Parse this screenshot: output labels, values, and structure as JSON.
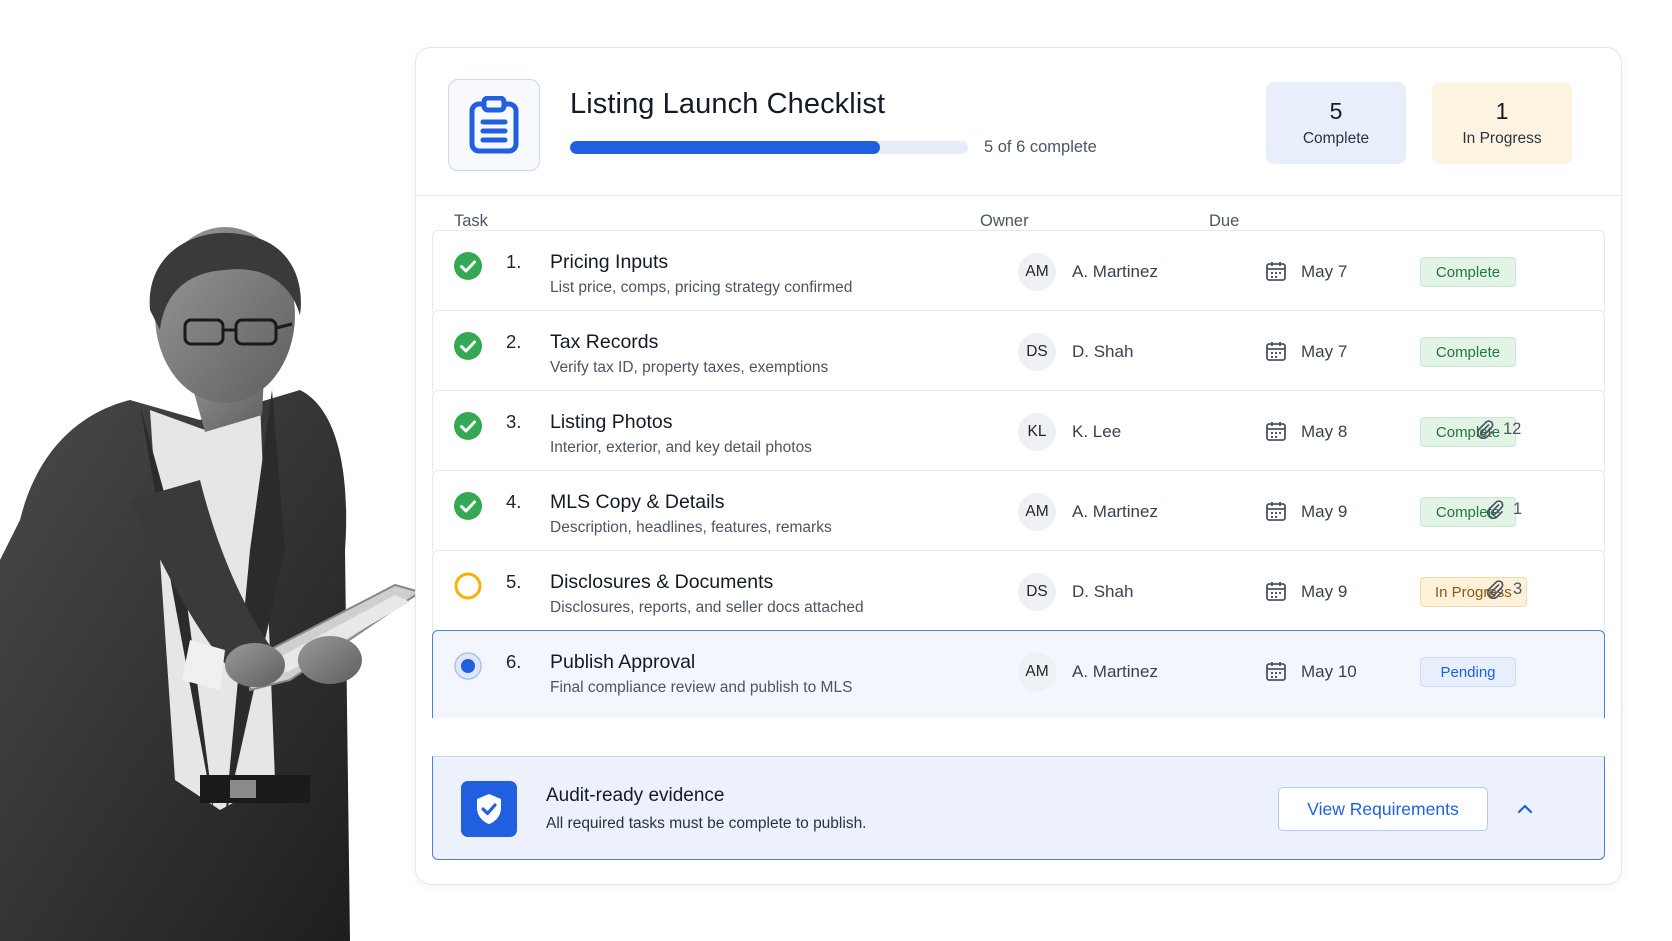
{
  "checklist": {
    "title": "Listing Launch Checklist",
    "progress_text": "5 of 6 complete",
    "progress_fraction": 0.78,
    "icon": "clipboard-icon"
  },
  "stats": [
    {
      "value": "5",
      "label": "Complete"
    },
    {
      "value": "1",
      "label": "In Progress"
    }
  ],
  "columns": {
    "task": "Task",
    "owner": "Owner",
    "due": "Due"
  },
  "tasks": [
    {
      "num": "1.",
      "title": "Pricing Inputs",
      "subtitle": "List price, comps, pricing strategy confirmed",
      "initials": "AM",
      "owner": "A. Martinez",
      "due": "May 7",
      "status": "Complete",
      "attachments": ""
    },
    {
      "num": "2.",
      "title": "Tax Records",
      "subtitle": "Verify tax ID, property taxes, exemptions",
      "initials": "DS",
      "owner": "D. Shah",
      "due": "May 7",
      "status": "Complete",
      "attachments": ""
    },
    {
      "num": "3.",
      "title": "Listing Photos",
      "subtitle": "Interior, exterior, and key detail photos",
      "initials": "KL",
      "owner": "K. Lee",
      "due": "May 8",
      "status": "Complete",
      "attachments": "12"
    },
    {
      "num": "4.",
      "title": "MLS Copy & Details",
      "subtitle": "Description, headlines, features, remarks",
      "initials": "AM",
      "owner": "A. Martinez",
      "due": "May 9",
      "status": "Complete",
      "attachments": "1"
    },
    {
      "num": "5.",
      "title": "Disclosures & Documents",
      "subtitle": "Disclosures, reports, and seller docs attached",
      "initials": "DS",
      "owner": "D. Shah",
      "due": "May 9",
      "status": "In Progress",
      "attachments": "3"
    },
    {
      "num": "6.",
      "title": "Publish Approval",
      "subtitle": "Final compliance review and publish to MLS",
      "initials": "AM",
      "owner": "A. Martinez",
      "due": "May 10",
      "status": "Pending",
      "attachments": ""
    }
  ],
  "audit": {
    "title": "Audit-ready evidence",
    "subtitle": "All required tasks must be complete to publish.",
    "button": "View Requirements"
  },
  "colors": {
    "accent": "#1f5fe0",
    "complete": "#34a853",
    "in_progress": "#f4b400"
  }
}
